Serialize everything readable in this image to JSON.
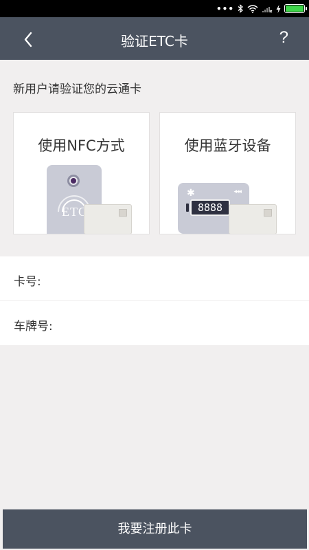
{
  "header": {
    "title": "验证ETC卡",
    "help_label": "?"
  },
  "prompt": "新用户请验证您的云通卡",
  "options": {
    "nfc": {
      "title": "使用NFC方式",
      "card_text": "ETC"
    },
    "bluetooth": {
      "title": "使用蓝牙设备",
      "display_value": "8888"
    }
  },
  "form": {
    "card_number_label": "卡号:",
    "card_number_value": "",
    "plate_label": "车牌号:",
    "plate_value": ""
  },
  "register_button": "我要注册此卡",
  "colors": {
    "header_bg": "#4b5360",
    "page_bg": "#f1efef",
    "battery": "#3fd64a"
  }
}
